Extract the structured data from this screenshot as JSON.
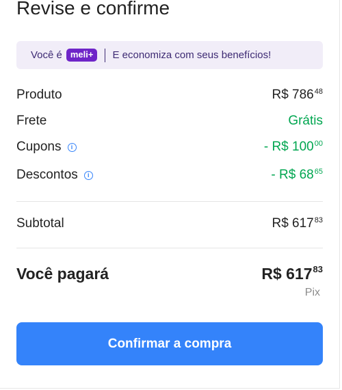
{
  "page": {
    "title": "Revise e confirme"
  },
  "banner": {
    "prefix": "Você é",
    "badge_text": "meli",
    "badge_plus": "+",
    "message": "E economiza com seus benefícios!"
  },
  "summary": {
    "produto": {
      "label": "Produto",
      "currency": "R$",
      "int": "786",
      "cents": "48"
    },
    "frete": {
      "label": "Frete",
      "value": "Grátis"
    },
    "cupons": {
      "label": "Cupons",
      "prefix": "- R$",
      "int": "100",
      "cents": "00"
    },
    "descontos": {
      "label": "Descontos",
      "prefix": "- R$",
      "int": "68",
      "cents": "65"
    },
    "subtotal": {
      "label": "Subtotal",
      "currency": "R$",
      "int": "617",
      "cents": "83"
    },
    "total": {
      "label": "Você pagará",
      "currency": "R$",
      "int": "617",
      "cents": "83",
      "method": "Pix"
    }
  },
  "actions": {
    "confirm_label": "Confirmar a compra"
  },
  "colors": {
    "accent": "#3483fa",
    "green": "#00a650",
    "badge": "#6e25c8",
    "banner_bg": "#f1edf8"
  }
}
